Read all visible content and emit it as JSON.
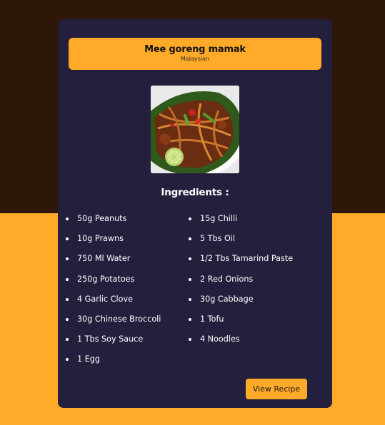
{
  "recipe": {
    "title": "Mee goreng mamak",
    "cuisine": "Malaysian",
    "image_icon": "food-photo",
    "ingredients_heading": "Ingredients :",
    "ingredients_left": [
      "50g Peanuts",
      "10g Prawns",
      "750 Ml Water",
      "250g Potatoes",
      "4 Garlic Clove",
      "30g Chinese Broccoli",
      "1 Tbs Soy Sauce",
      "1 Egg"
    ],
    "ingredients_right": [
      "15g Chilli",
      "5 Tbs Oil",
      "1/2 Tbs Tamarind Paste",
      "2 Red Onions",
      "30g Cabbage",
      "1 Tofu",
      "4 Noodles"
    ],
    "view_button_label": "View Recipe"
  },
  "colors": {
    "page_top": "#2e1709",
    "page_bottom": "#ffaa28",
    "card_background": "#231f3d",
    "accent": "#ffaa28",
    "text_light": "#ffffff"
  }
}
